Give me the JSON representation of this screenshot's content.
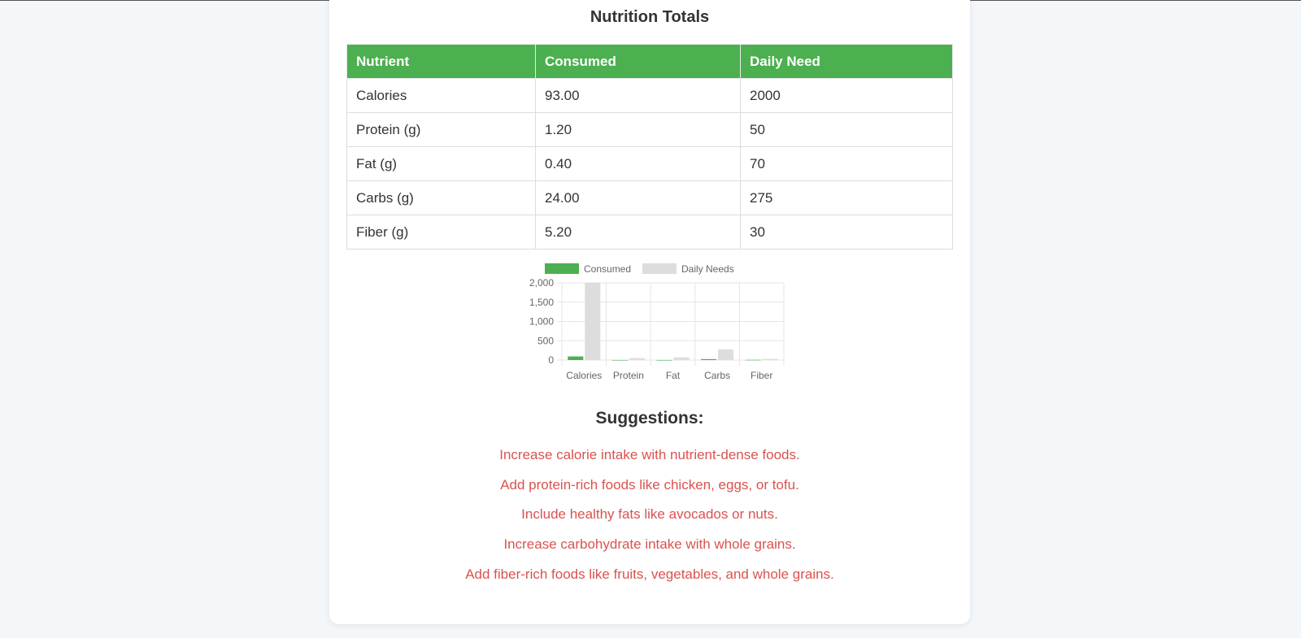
{
  "page": {
    "title": "Nutrition Totals",
    "accent_color": "#4caf50",
    "suggestion_color": "#d9534f"
  },
  "table": {
    "headers": [
      "Nutrient",
      "Consumed",
      "Daily Need"
    ],
    "rows": [
      [
        "Calories",
        "93.00",
        "2000"
      ],
      [
        "Protein (g)",
        "1.20",
        "50"
      ],
      [
        "Fat (g)",
        "0.40",
        "70"
      ],
      [
        "Carbs (g)",
        "24.00",
        "275"
      ],
      [
        "Fiber (g)",
        "5.20",
        "30"
      ]
    ]
  },
  "chart_data": {
    "type": "bar",
    "categories": [
      "Calories",
      "Protein",
      "Fat",
      "Carbs",
      "Fiber"
    ],
    "series": [
      {
        "name": "Consumed",
        "values": [
          93,
          1.2,
          0.4,
          24,
          5.2
        ],
        "color": "#4caf50"
      },
      {
        "name": "Daily Needs",
        "values": [
          2000,
          50,
          70,
          275,
          30
        ],
        "color": "#dddddd"
      }
    ],
    "y_ticks": [
      "2,000",
      "1,500",
      "1,000",
      "500",
      "0"
    ],
    "ylim": [
      0,
      2000
    ],
    "grid": true,
    "legend": "top"
  },
  "suggestions": {
    "title": "Suggestions:",
    "items": [
      "Increase calorie intake with nutrient-dense foods.",
      "Add protein-rich foods like chicken, eggs, or tofu.",
      "Include healthy fats like avocados or nuts.",
      "Increase carbohydrate intake with whole grains.",
      "Add fiber-rich foods like fruits, vegetables, and whole grains."
    ]
  }
}
